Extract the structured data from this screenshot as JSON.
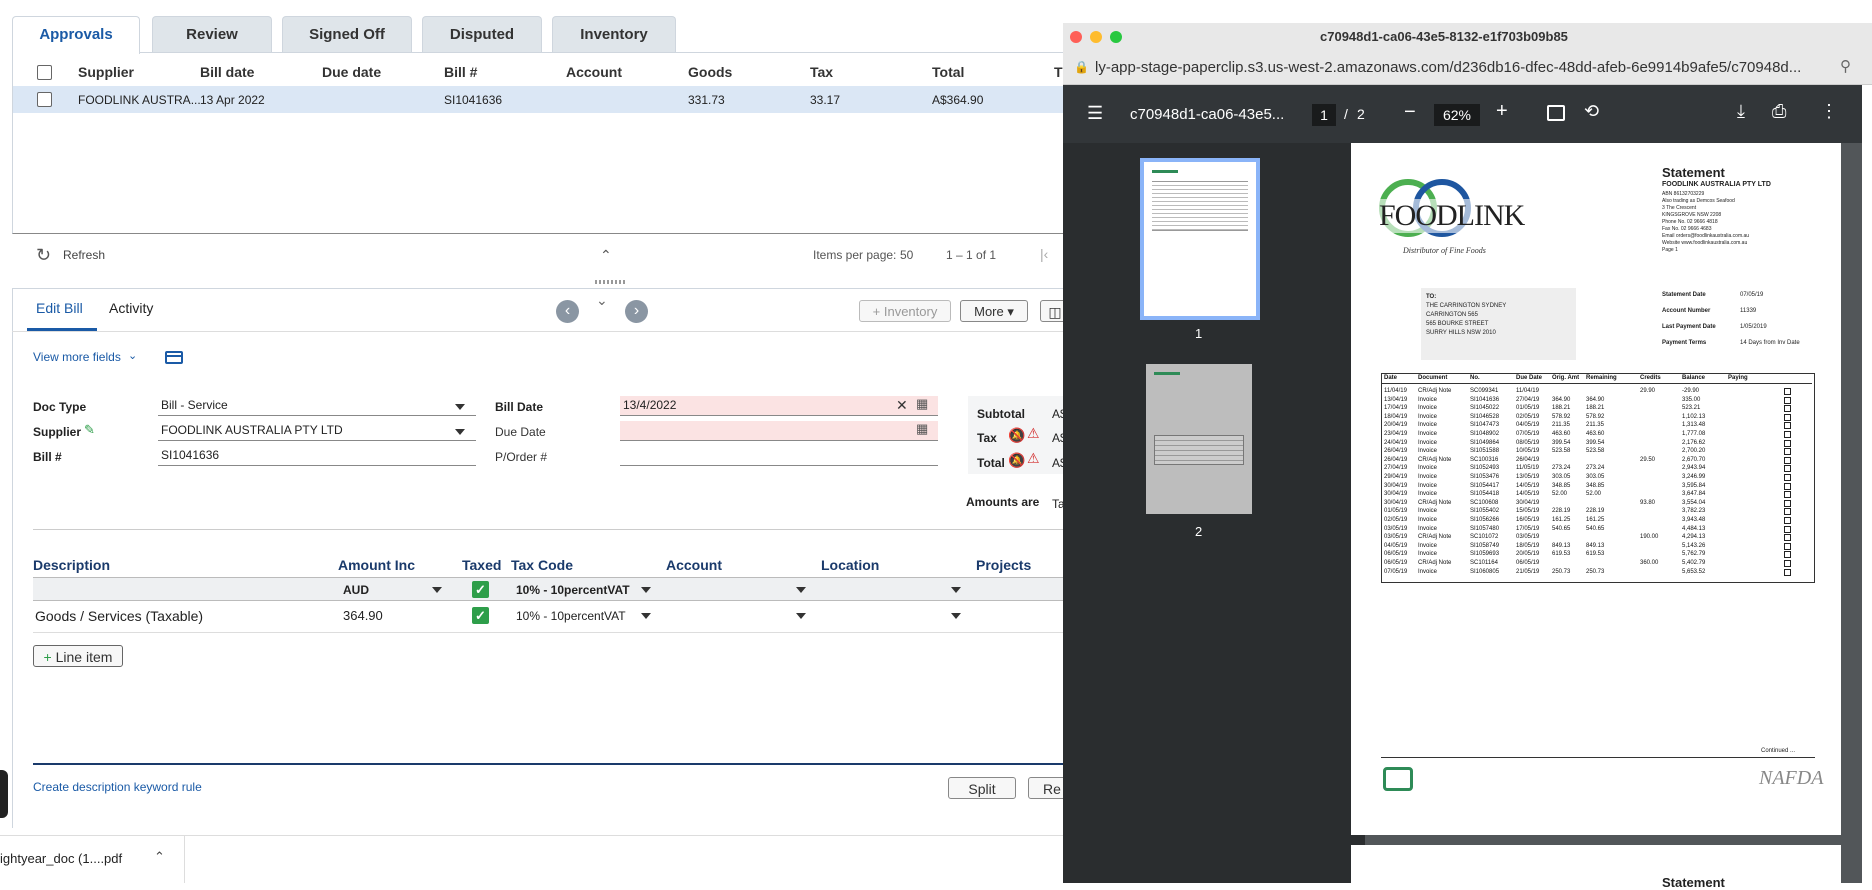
{
  "tabs": [
    "Approvals",
    "Review",
    "Signed Off",
    "Disputed",
    "Inventory"
  ],
  "table": {
    "headers": [
      "Supplier",
      "Bill date",
      "Due date",
      "Bill #",
      "Account",
      "Goods",
      "Tax",
      "Total",
      "T"
    ],
    "row": {
      "supplier": "FOODLINK AUSTRA...",
      "bill_date": "13 Apr 2022",
      "due_date": "",
      "bill_no": "SI1041636",
      "account": "",
      "goods": "331.73",
      "tax": "33.17",
      "total": "A$364.90"
    },
    "refresh": "Refresh",
    "items_per_page_label": "Items per page:",
    "items_per_page": "50",
    "range": "1 – 1 of 1"
  },
  "edit": {
    "tabs": [
      "Edit Bill",
      "Activity"
    ],
    "inventory_btn": "Inventory",
    "more_btn": "More",
    "view_more": "View more fields",
    "doc_type_label": "Doc Type",
    "doc_type": "Bill - Service",
    "supplier_label": "Supplier",
    "supplier": "FOODLINK AUSTRALIA PTY LTD",
    "bill_no_label": "Bill #",
    "bill_no": "SI1041636",
    "bill_date_label": "Bill Date",
    "bill_date": "13/4/2022",
    "due_date_label": "Due Date",
    "porder_label": "P/Order #",
    "subtotal_label": "Subtotal",
    "tax_label": "Tax",
    "total_label": "Total",
    "amount_prefix": "A$",
    "amounts_are_label": "Amounts are",
    "amounts_are": "Ta",
    "lines": {
      "headers": [
        "Description",
        "Amount Inc",
        "Taxed",
        "Tax Code",
        "Account",
        "Location",
        "Projects"
      ],
      "currency": "AUD",
      "default_tax_code": "10% - 10percentVAT",
      "line": {
        "description": "Goods / Services (Taxable)",
        "amount": "364.90",
        "tax_code": "10% - 10percentVAT"
      },
      "add_line": "Line item"
    },
    "keyword_rule": "Create description keyword rule",
    "split_btn": "Split",
    "re_btn": "Re"
  },
  "download": {
    "file": "ightyear_doc (1....pdf"
  },
  "pdf": {
    "window_title": "c70948d1-ca06-43e5-8132-e1f703b09b85",
    "url": "ly-app-stage-paperclip.s3.us-west-2.amazonaws.com/d236db16-dfec-48dd-afeb-6e9914b9afe5/c70948d...",
    "doc_title": "c70948d1-ca06-43e5...",
    "page": "1",
    "pages": "2",
    "zoom": "62%",
    "thumbs": [
      "1",
      "2"
    ],
    "statement": {
      "heading": "Statement",
      "company": "FOODLINK AUSTRALIA PTY LTD",
      "abn": "ABN   86132703229",
      "trading": "Also trading as Demcos Seafood",
      "address1": "3 The Crescent",
      "address2": "KINGSGROVE NSW  2208",
      "phone": "Phone No.      02 9666 4818",
      "fax": "Fax No.         02 9666 4683",
      "email": "Email            orders@foodlinkaustralia.com.au",
      "website": "Website         www.foodlinkaustralia.com.au",
      "page": "Page             1",
      "logo_text": "FOODLINK",
      "tagline": "Distributor of Fine Foods",
      "to_label": "TO:",
      "to": [
        "THE CARRINGTON SYDNEY",
        "CARRINGTON 565",
        "565 BOURKE STREET",
        "SURRY HILLS NSW  2010"
      ],
      "meta": [
        [
          "Statement Date",
          "07/05/19"
        ],
        [
          "Account Number",
          "11339"
        ],
        [
          "Last Payment Date",
          "1/05/2019"
        ],
        [
          "Payment Terms",
          "14 Days from Inv Date"
        ]
      ],
      "cols": [
        "Date",
        "Document",
        "No.",
        "Due Date",
        "Orig. Amt",
        "Remaining",
        "Credits",
        "Balance",
        "Paying"
      ],
      "rows": [
        [
          "11/04/19",
          "CR/Adj Note",
          "SC099341",
          "11/04/19",
          "",
          "",
          "29.90",
          "-29.90"
        ],
        [
          "13/04/19",
          "Invoice",
          "SI1041636",
          "27/04/19",
          "364.90",
          "364.90",
          "",
          "335.00"
        ],
        [
          "17/04/19",
          "Invoice",
          "SI1045022",
          "01/05/19",
          "188.21",
          "188.21",
          "",
          "523.21"
        ],
        [
          "18/04/19",
          "Invoice",
          "SI1046528",
          "02/05/19",
          "578.92",
          "578.92",
          "",
          "1,102.13"
        ],
        [
          "20/04/19",
          "Invoice",
          "SI1047473",
          "04/05/19",
          "211.35",
          "211.35",
          "",
          "1,313.48"
        ],
        [
          "23/04/19",
          "Invoice",
          "SI1048902",
          "07/05/19",
          "463.60",
          "463.60",
          "",
          "1,777.08"
        ],
        [
          "24/04/19",
          "Invoice",
          "SI1049864",
          "08/05/19",
          "399.54",
          "399.54",
          "",
          "2,176.62"
        ],
        [
          "26/04/19",
          "Invoice",
          "SI1051588",
          "10/05/19",
          "523.58",
          "523.58",
          "",
          "2,700.20"
        ],
        [
          "26/04/19",
          "CR/Adj Note",
          "SC100316",
          "26/04/19",
          "",
          "",
          "29.50",
          "2,670.70"
        ],
        [
          "27/04/19",
          "Invoice",
          "SI1052493",
          "11/05/19",
          "273.24",
          "273.24",
          "",
          "2,943.94"
        ],
        [
          "29/04/19",
          "Invoice",
          "SI1053476",
          "13/05/19",
          "303.05",
          "303.05",
          "",
          "3,246.99"
        ],
        [
          "30/04/19",
          "Invoice",
          "SI1054417",
          "14/05/19",
          "348.85",
          "348.85",
          "",
          "3,595.84"
        ],
        [
          "30/04/19",
          "Invoice",
          "SI1054418",
          "14/05/19",
          "52.00",
          "52.00",
          "",
          "3,647.84"
        ],
        [
          "30/04/19",
          "CR/Adj Note",
          "SC100608",
          "30/04/19",
          "",
          "",
          "93.80",
          "3,554.04"
        ],
        [
          "01/05/19",
          "Invoice",
          "SI1055402",
          "15/05/19",
          "228.19",
          "228.19",
          "",
          "3,782.23"
        ],
        [
          "02/05/19",
          "Invoice",
          "SI1056266",
          "16/05/19",
          "161.25",
          "161.25",
          "",
          "3,943.48"
        ],
        [
          "03/05/19",
          "Invoice",
          "SI1057480",
          "17/05/19",
          "540.65",
          "540.65",
          "",
          "4,484.13"
        ],
        [
          "03/05/19",
          "CR/Adj Note",
          "SC101072",
          "03/05/19",
          "",
          "",
          "190.00",
          "4,294.13"
        ],
        [
          "04/05/19",
          "Invoice",
          "SI1058749",
          "18/05/19",
          "849.13",
          "849.13",
          "",
          "5,143.26"
        ],
        [
          "06/05/19",
          "Invoice",
          "SI1059693",
          "20/05/19",
          "619.53",
          "619.53",
          "",
          "5,762.79"
        ],
        [
          "06/05/19",
          "CR/Adj Note",
          "SC101164",
          "06/05/19",
          "",
          "",
          "360.00",
          "5,402.79"
        ],
        [
          "07/05/19",
          "Invoice",
          "SI1060805",
          "21/05/19",
          "250.73",
          "250.73",
          "",
          "5,653.52"
        ]
      ],
      "continued": "Continued ...",
      "nafda": "NAFDA",
      "next_heading": "Statement"
    }
  }
}
